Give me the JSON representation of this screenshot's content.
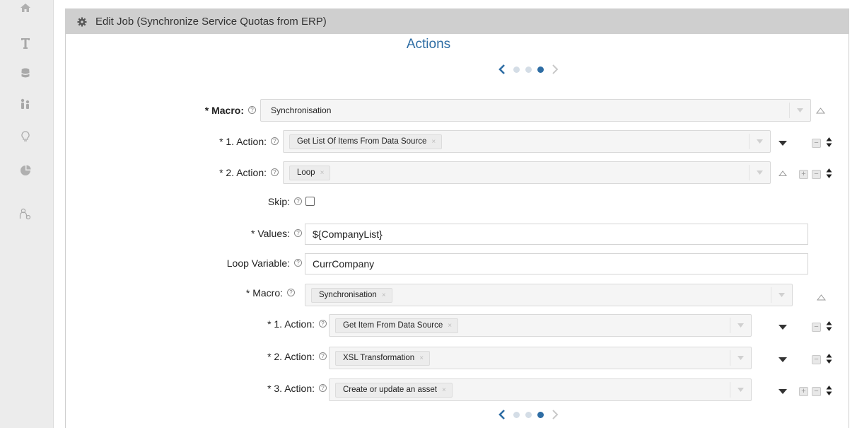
{
  "dialog": {
    "title": "Edit Job (Synchronize Service Quotas from ERP)"
  },
  "section": {
    "title": "Actions"
  },
  "sidebar": {
    "icons": [
      "home-icon",
      "text-icon",
      "database-icon",
      "users-icon",
      "lightbulb-icon",
      "chart-icon",
      "user-settings-icon"
    ]
  },
  "pager": {
    "pages": 3,
    "active_page": 3
  },
  "help_glyph": "?",
  "form": {
    "macro": {
      "label": "* Macro:",
      "value": "Synchronisation"
    },
    "action1": {
      "label": "* 1. Action:",
      "value": "Get List Of Items From Data Source",
      "remove": "×"
    },
    "action2": {
      "label": "* 2. Action:",
      "value": "Loop",
      "remove": "×"
    },
    "skip": {
      "label": "Skip:",
      "checked": false
    },
    "values": {
      "label": "* Values:",
      "value": "${CompanyList}"
    },
    "loop_variable": {
      "label": "Loop Variable:",
      "value": "CurrCompany"
    },
    "inner_macro": {
      "label": "* Macro:",
      "value": "Synchronisation",
      "remove": "×"
    },
    "inner_action1": {
      "label": "* 1. Action:",
      "value": "Get Item From Data Source",
      "remove": "×"
    },
    "inner_action2": {
      "label": "* 2. Action:",
      "value": "XSL Transformation",
      "remove": "×"
    },
    "inner_action3": {
      "label": "* 3. Action:",
      "value": "Create or update an asset",
      "remove": "×"
    }
  },
  "colors": {
    "accent": "#2e6da4",
    "header_bg": "#cfcfcf",
    "sidebar_bg": "#ececec"
  }
}
